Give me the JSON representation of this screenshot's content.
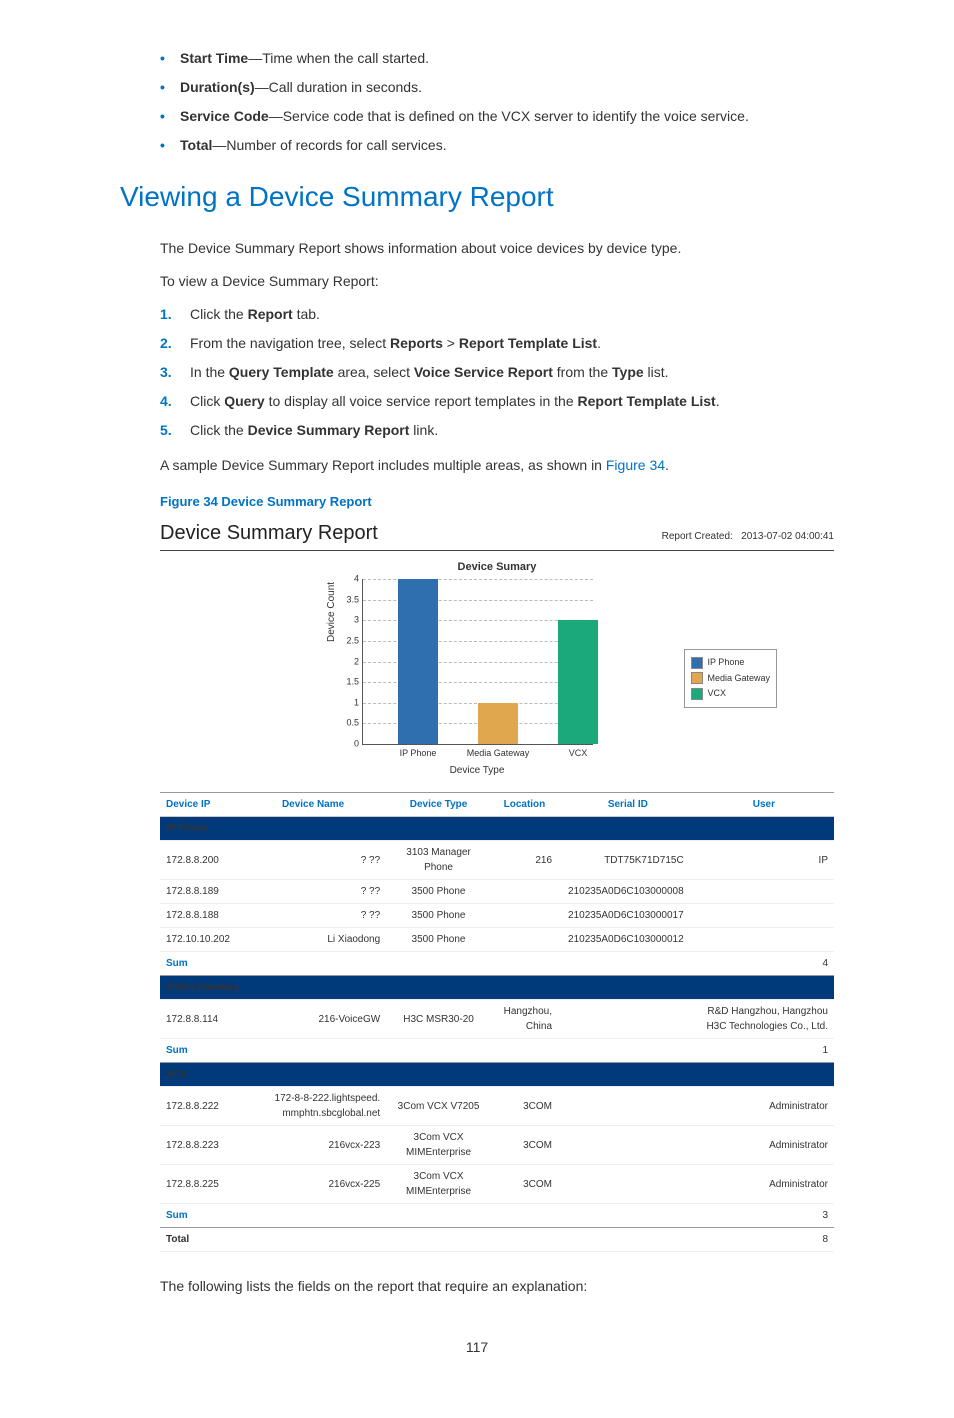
{
  "bullets": [
    {
      "term": "Start Time",
      "desc": "—Time when the call started."
    },
    {
      "term": "Duration(s)",
      "desc": "—Call duration in seconds."
    },
    {
      "term": "Service Code",
      "desc": "—Service code that is defined on the VCX server to identify the voice service."
    },
    {
      "term": "Total",
      "desc": "—Number of records for call services."
    }
  ],
  "heading": "Viewing a Device Summary Report",
  "para1": "The Device Summary Report shows information about voice devices by device type.",
  "para2": "To view a Device Summary Report:",
  "steps": [
    {
      "pre": "Click the ",
      "b": "Report",
      "post": " tab."
    },
    {
      "pre": "From the navigation tree, select ",
      "b": "Reports",
      "mid": " > ",
      "b2": "Report Template List",
      "post": "."
    },
    {
      "pre": "In the ",
      "b": "Query Template",
      "mid": " area, select ",
      "b2": "Voice Service Report",
      "mid2": " from the ",
      "b3": "Type",
      "post": " list."
    },
    {
      "pre": "Click ",
      "b": "Query",
      "mid": " to display all voice service report templates in the ",
      "b2": "Report Template List",
      "post": "."
    },
    {
      "pre": "Click the ",
      "b": "Device Summary Report",
      "post": " link."
    }
  ],
  "sample_line_pre": "A sample Device Summary Report includes multiple areas, as shown in ",
  "sample_line_link": "Figure 34",
  "sample_line_post": ".",
  "figure_caption": "Figure 34 Device Summary Report",
  "report": {
    "title": "Device Summary Report",
    "created_label": "Report Created:",
    "created_value": "2013-07-02 04:00:41",
    "chart_title": "Device Sumary",
    "ylabel": "Device Count",
    "xlabel": "Device Type",
    "legend": [
      "IP Phone",
      "Media Gateway",
      "VCX"
    ],
    "columns": [
      "Device IP",
      "Device Name",
      "Device Type",
      "Location",
      "Serial ID",
      "User"
    ],
    "groups": [
      {
        "name": "IP Phone",
        "rows": [
          {
            "ip": "172.8.8.200",
            "name": "? ??",
            "type": "3103 Manager Phone",
            "loc": "216",
            "serial": "TDT75K71D715C",
            "user": "IP"
          },
          {
            "ip": "172.8.8.189",
            "name": "? ??",
            "type": "3500 Phone",
            "loc": "",
            "serial": "210235A0D6C103000008",
            "user": ""
          },
          {
            "ip": "172.8.8.188",
            "name": "? ??",
            "type": "3500 Phone",
            "loc": "",
            "serial": "210235A0D6C103000017",
            "user": ""
          },
          {
            "ip": "172.10.10.202",
            "name": "Li Xiaodong",
            "type": "3500 Phone",
            "loc": "",
            "serial": "210235A0D6C103000012",
            "user": ""
          }
        ],
        "sum": "4"
      },
      {
        "name": "Media Gateway",
        "rows": [
          {
            "ip": "172.8.8.114",
            "name": "216-VoiceGW",
            "type": "H3C MSR30-20",
            "loc": "Hangzhou, China",
            "serial": "",
            "user": "R&D Hangzhou, Hangzhou H3C Technologies Co., Ltd."
          }
        ],
        "sum": "1"
      },
      {
        "name": "VCX",
        "rows": [
          {
            "ip": "172.8.8.222",
            "name": "172-8-8-222.lightspeed. mmphtn.sbcglobal.net",
            "type": "3Com VCX V7205",
            "loc": "3COM",
            "serial": "",
            "user": "Administrator"
          },
          {
            "ip": "172.8.8.223",
            "name": "216vcx-223",
            "type": "3Com VCX MIMEnterprise",
            "loc": "3COM",
            "serial": "",
            "user": "Administrator"
          },
          {
            "ip": "172.8.8.225",
            "name": "216vcx-225",
            "type": "3Com VCX MIMEnterprise",
            "loc": "3COM",
            "serial": "",
            "user": "Administrator"
          }
        ],
        "sum": "3"
      }
    ],
    "sum_label": "Sum",
    "total_label": "Total",
    "total_value": "8"
  },
  "closing": "The following lists the fields on the report that require an explanation:",
  "page_number": "117",
  "chart_data": {
    "type": "bar",
    "title": "Device Sumary",
    "xlabel": "Device Type",
    "ylabel": "Device Count",
    "categories": [
      "IP Phone",
      "Media Gateway",
      "VCX"
    ],
    "values": [
      4,
      1,
      3
    ],
    "ylim": [
      0,
      4
    ],
    "yticks": [
      0,
      0.5,
      1,
      1.5,
      2,
      2.5,
      3,
      3.5,
      4
    ],
    "colors": {
      "IP Phone": "#2f6fb0",
      "Media Gateway": "#e0a74e",
      "VCX": "#19a97b"
    },
    "legend_position": "right"
  }
}
